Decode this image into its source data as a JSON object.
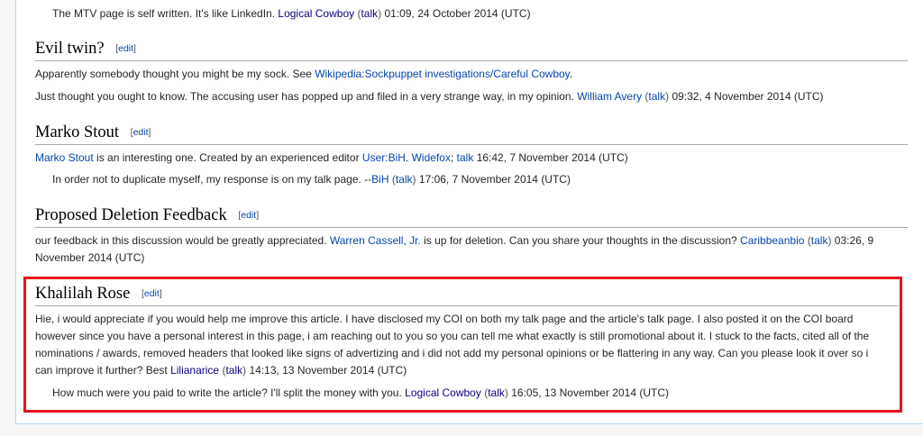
{
  "top_comment": {
    "text": "The MTV page is self written. It's like LinkedIn.",
    "user": "Logical Cowboy",
    "talk": "talk",
    "timestamp": "01:09, 24 October 2014 (UTC)"
  },
  "sections": {
    "evil_twin": {
      "title": "Evil twin?",
      "edit": "edit",
      "p1_text": "Apparently somebody thought you might be my sock. See",
      "p1_link": "Wikipedia:Sockpuppet investigations/Careful Cowboy",
      "p1_end": ".",
      "p2_text": "Just thought you ought to know. The accusing user has popped up and filed in a very strange way, in my opinion.",
      "p2_user": "William Avery",
      "p2_talk": "talk",
      "p2_timestamp": "09:32, 4 November 2014 (UTC)"
    },
    "marko_stout": {
      "title": "Marko Stout",
      "edit": "edit",
      "p1_link": "Marko Stout",
      "p1_text": "is an interesting one. Created by an experienced editor",
      "p1_user": "User:BiH",
      "p1_sep": ".",
      "p1_user2": "Widefox",
      "p1_talk": "talk",
      "p1_timestamp": "16:42, 7 November 2014 (UTC)",
      "reply_text": "In order not to duplicate myself, my response is on my talk page. --",
      "reply_user": "BiH",
      "reply_talk": "talk",
      "reply_timestamp": "17:06, 7 November 2014 (UTC)"
    },
    "proposed_deletion": {
      "title": "Proposed Deletion Feedback",
      "edit": "edit",
      "line1_text": "our feedback in this discussion would be greatly appreciated.",
      "line1_link": "Warren Cassell, Jr.",
      "line1_text2": "is up for deletion. Can you share your thoughts in the discussion?",
      "line1_user": "Caribbeanbio",
      "line1_talk": "talk",
      "line1_timestamp": "03:26, 9",
      "line2_text": "November 2014 (UTC)"
    },
    "khalilah_rose": {
      "title": "Khalilah Rose",
      "edit": "edit",
      "body_line1": "Hie, i would appreciate if you would help me improve this article. I have disclosed my COI on both my talk page and the article's talk page. I also posted it on the COI board",
      "body_line2": "however since you have a personal interest in this page, i am reaching out to you so you can tell me what exactly is still promotional about it. I stuck to the facts, cited all of the",
      "body_line3": "nominations / awards, removed headers that looked like signs of advertizing and i did not add my personal opinions or be flattering in any way. Can you please look it over so i",
      "body_line4": "can improve it further? Best",
      "body_user": "Lilianarice",
      "body_talk": "talk",
      "body_timestamp": "14:13, 13 November 2014 (UTC)",
      "reply_text": "How much were you paid to write the article? I'll split the money with you.",
      "reply_user": "Logical Cowboy",
      "reply_talk": "talk",
      "reply_timestamp": "16:05, 13 November 2014 (UTC)"
    }
  },
  "colors": {
    "link": "#0645ad",
    "visited_link": "#0b0080",
    "highlight_border": "#e8141b"
  }
}
